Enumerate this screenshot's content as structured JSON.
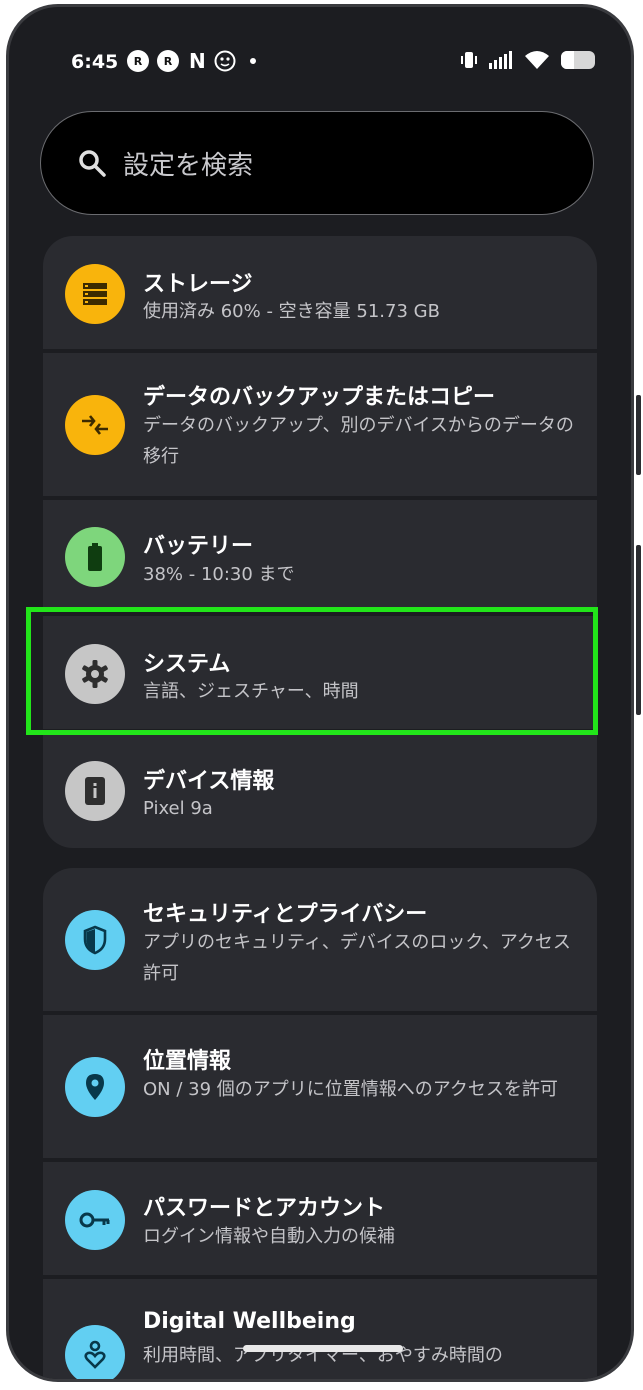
{
  "status_bar": {
    "time": "6:45",
    "notification_icons": [
      "R",
      "R",
      "N"
    ],
    "icons": [
      "rakuten-icon",
      "rakuten-icon",
      "netflix-icon",
      "app-icon",
      "dot-icon",
      "vibrate-icon",
      "signal-icon",
      "wifi-icon",
      "battery-icon"
    ]
  },
  "search": {
    "placeholder": "設定を検索"
  },
  "settings": {
    "group1": [
      {
        "title": "ストレージ",
        "subtitle": "使用済み 60% - 空き容量 51.73 GB",
        "icon": "storage-icon",
        "color": "#f9b40c"
      },
      {
        "title": "データのバックアップまたはコピー",
        "subtitle": "データのバックアップ、別のデバイスからのデータの移行",
        "icon": "backup-transfer-icon",
        "color": "#f9b40c"
      },
      {
        "title": "バッテリー",
        "subtitle": "38% - 10:30 まで",
        "icon": "battery-icon",
        "color": "#7ed67c"
      },
      {
        "title": "システム",
        "subtitle": "言語、ジェスチャー、時間",
        "icon": "gear-icon",
        "color": "#c6c6c6"
      },
      {
        "title": "デバイス情報",
        "subtitle": "Pixel 9a",
        "icon": "device-info-icon",
        "color": "#c6c6c6"
      }
    ],
    "group2": [
      {
        "title": "セキュリティとプライバシー",
        "subtitle": "アプリのセキュリティ、デバイスのロック、アクセス許可",
        "icon": "shield-icon",
        "color": "#62cff2"
      },
      {
        "title": "位置情報",
        "subtitle": "ON / 39 個のアプリに位置情報へのアクセスを許可",
        "icon": "location-icon",
        "color": "#62cff2"
      },
      {
        "title": "パスワードとアカウント",
        "subtitle": "ログイン情報や自動入力の候補",
        "icon": "key-icon",
        "color": "#62cff2"
      },
      {
        "title": "Digital Wellbeing",
        "subtitle": "利用時間、アプリタイマー、おやすみ時間の",
        "icon": "wellbeing-icon",
        "color": "#62cff2"
      }
    ]
  },
  "highlight_color": "#22e51a"
}
